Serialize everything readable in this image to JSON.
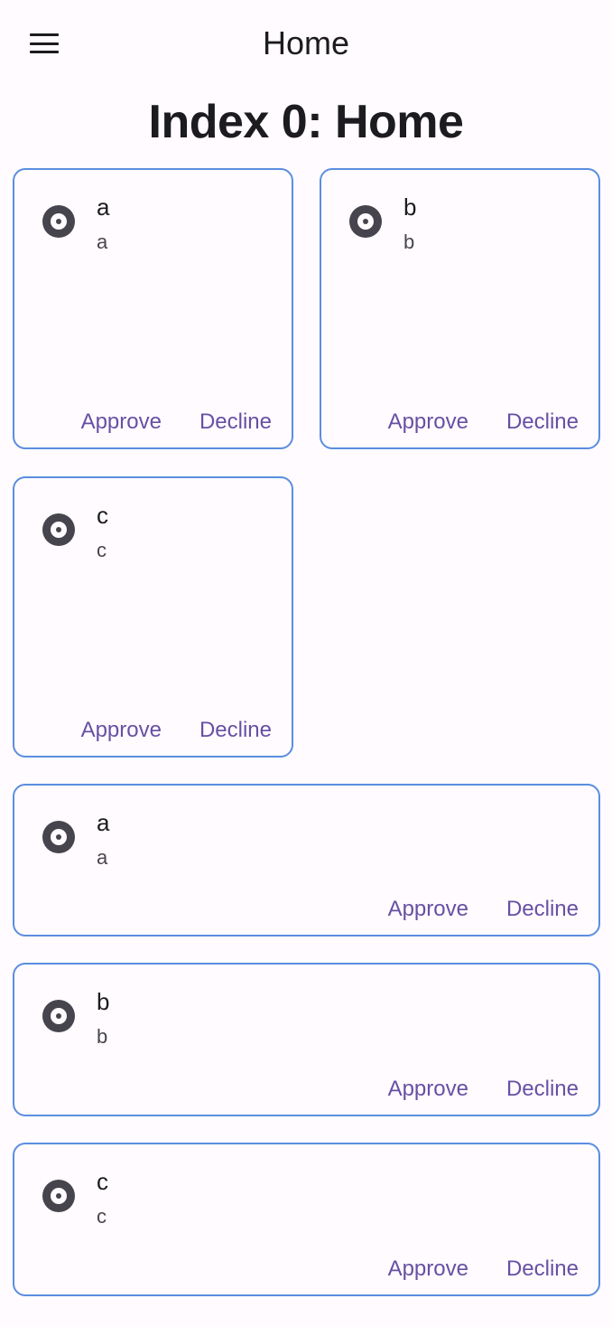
{
  "appbar": {
    "title": "Home",
    "menu_icon": "hamburger-menu-icon"
  },
  "heading": "Index 0: Home",
  "grid_cards": [
    {
      "title": "a",
      "subtitle": "a",
      "icon": "album-icon",
      "approve_label": "Approve",
      "decline_label": "Decline"
    },
    {
      "title": "b",
      "subtitle": "b",
      "icon": "album-icon",
      "approve_label": "Approve",
      "decline_label": "Decline"
    },
    {
      "title": "c",
      "subtitle": "c",
      "icon": "album-icon",
      "approve_label": "Approve",
      "decline_label": "Decline"
    }
  ],
  "list_cards": [
    {
      "title": "a",
      "subtitle": "a",
      "icon": "album-icon",
      "approve_label": "Approve",
      "decline_label": "Decline"
    },
    {
      "title": "b",
      "subtitle": "b",
      "icon": "album-icon",
      "approve_label": "Approve",
      "decline_label": "Decline"
    },
    {
      "title": "c",
      "subtitle": "c",
      "icon": "album-icon",
      "approve_label": "Approve",
      "decline_label": "Decline"
    }
  ],
  "colors": {
    "background": "#fffbfe",
    "card_border": "#5b8ee0",
    "action_text": "#6750a4",
    "icon": "#46444c"
  }
}
